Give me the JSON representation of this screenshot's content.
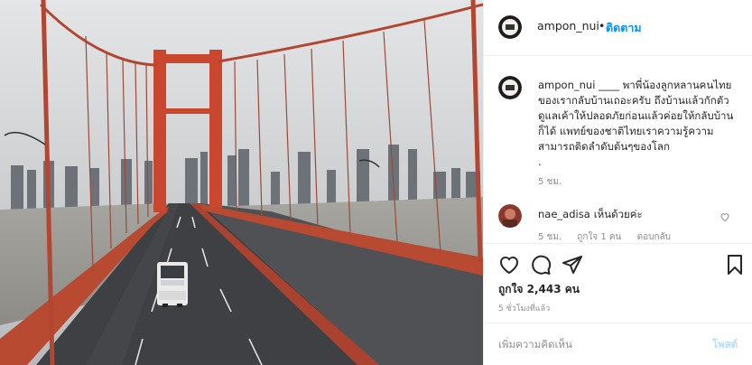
{
  "post": {
    "image_alt": "empty suspension bridge with ambulance",
    "username": "ampon_nui",
    "follow_label": "ติดตาม",
    "separator": "•"
  },
  "caption": {
    "username": "ampon_nui",
    "text": "____ พาพี่น้องลูกหลานคนไทยของเรากลับบ้านเถอะครับ ถึงบ้านแล้วกักตัวดูแลเค้าให้ปลอดภัยก่อนแล้วค่อยให้กลับบ้านก็ได้ แพทย์ของชาติไทยเราความรู้ความสามารถติดลำดับต้นๆของโลก\n.",
    "time": "5 ชม."
  },
  "comments": [
    {
      "username": "nae_adisa",
      "text": "เห็นด้วยค่ะ",
      "time": "5 ชม.",
      "likes": "ถูกใจ 1 คน",
      "reply": "ตอบกลับ"
    }
  ],
  "actions": {
    "icons": [
      "heart-icon",
      "comment-icon",
      "share-icon",
      "bookmark-icon"
    ],
    "likes": "ถูกใจ 2,443 คน",
    "posted": "5 ชั่วโมงที่แล้ว"
  },
  "add_comment": {
    "placeholder": "เพิ่มความคิดเห็น",
    "post_label": "โพสต์"
  },
  "colors": {
    "link": "#0095f6",
    "muted": "#8e8e8e",
    "post_disabled": "#b2dffc",
    "bridge": "#c8472e"
  }
}
